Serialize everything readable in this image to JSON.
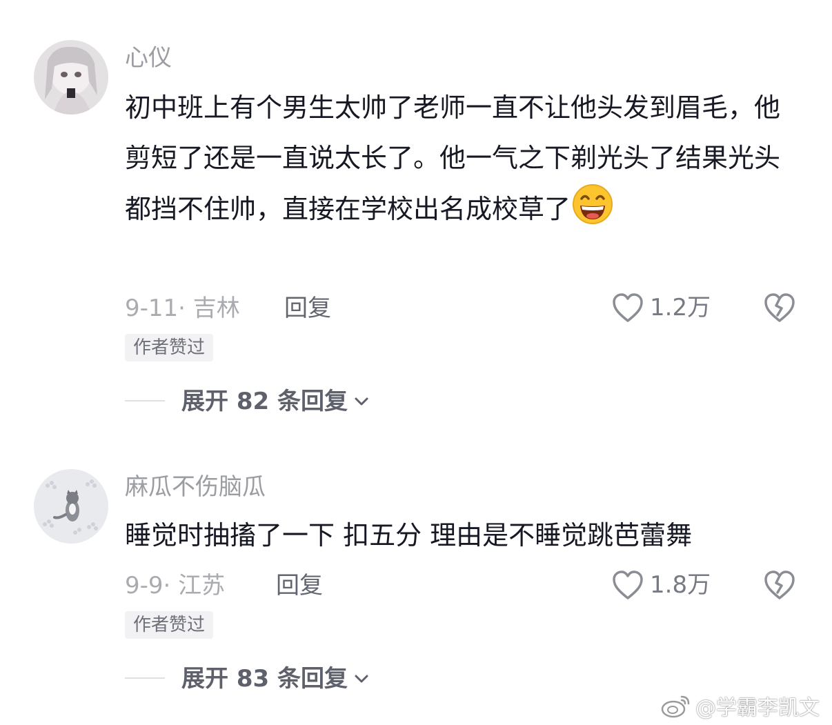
{
  "comments": [
    {
      "username": "心仪",
      "text": "初中班上有个男生太帅了老师一直不让他头发到眉毛，他剪短了还是一直说太长了。他一气之下剃光头了结果光头都挡不住帅，直接在学校出名成校草了",
      "emoji": "grinning-face-emoji",
      "date_location": "9-11· 吉林",
      "reply_label": "回复",
      "likes": "1.2万",
      "badge": "作者赞过",
      "expand_label": "展开 82 条回复"
    },
    {
      "username": "麻瓜不伤脑瓜",
      "text": "睡觉时抽搐了一下 扣五分 理由是不睡觉跳芭蕾舞",
      "date_location": "9-9· 江苏",
      "reply_label": "回复",
      "likes": "1.8万",
      "badge": "作者赞过",
      "expand_label": "展开 83 条回复"
    }
  ],
  "watermark": {
    "text": "@学霸李凯文",
    "icon": "weibo-logo-icon"
  },
  "icons": {
    "like": "heart-outline-icon",
    "dislike": "broken-heart-icon",
    "expand": "chevron-down-icon"
  },
  "colors": {
    "text_primary": "#161823",
    "text_secondary": "#a9abb0",
    "badge_bg": "#f2f2f4"
  }
}
